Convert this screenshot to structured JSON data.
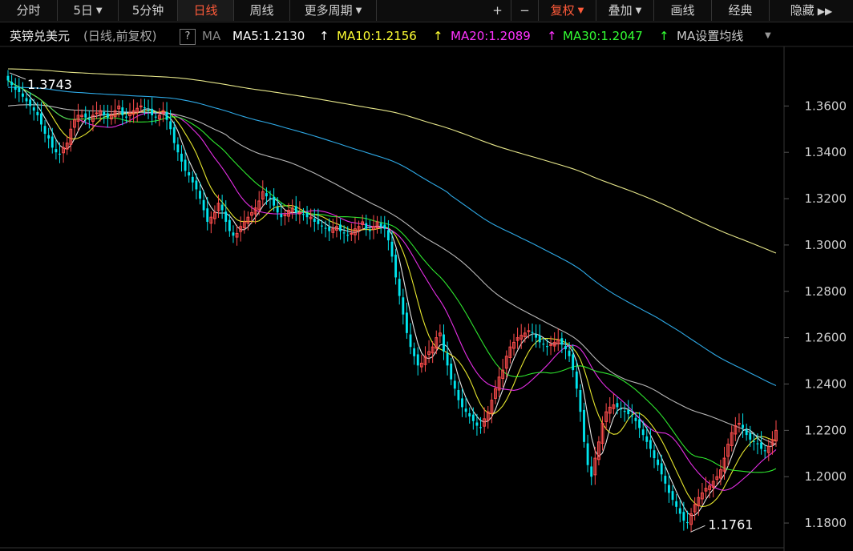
{
  "toolbar": {
    "tabs": [
      "分时",
      "5日",
      "5分钟",
      "日线",
      "周线",
      "更多周期"
    ],
    "active_tab": "日线",
    "right": [
      "+",
      "−",
      "复权",
      "叠加",
      "画线",
      "经典",
      "隐藏"
    ]
  },
  "legend": {
    "symbol": "英镑兑美元",
    "mode": "(日线,前复权)",
    "help": "?",
    "ma_label": "MA",
    "ma5": "MA5:1.2130",
    "ma10": "MA10:1.2156",
    "ma20": "MA20:1.2089",
    "ma30": "MA30:1.2047",
    "ma_setting": "MA设置均线",
    "arrow": "↑"
  },
  "colors": {
    "up": "#ff4d4d",
    "down": "#00e5ee",
    "ma5": "#ffffff",
    "ma10": "#ffff33",
    "ma20": "#ff33ff",
    "ma30": "#33ff33",
    "ma60": "#cccccc",
    "ma120": "#33bbff",
    "ma250": "#ffff99"
  },
  "chart_data": {
    "type": "candlestick",
    "title": "英镑兑美元",
    "ylim": [
      1.17,
      1.385
    ],
    "yticks": [
      "1.3600",
      "1.3400",
      "1.3200",
      "1.3000",
      "1.2800",
      "1.2600",
      "1.2400",
      "1.2200",
      "1.2000",
      "1.1800"
    ],
    "annotations": {
      "high": "1.3743",
      "low": "1.1761"
    },
    "close": [
      1.371,
      1.369,
      1.367,
      1.366,
      1.364,
      1.362,
      1.36,
      1.358,
      1.356,
      1.352,
      1.348,
      1.346,
      1.342,
      1.34,
      1.339,
      1.342,
      1.344,
      1.35,
      1.354,
      1.356,
      1.356,
      1.355,
      1.354,
      1.356,
      1.357,
      1.358,
      1.356,
      1.355,
      1.356,
      1.358,
      1.36,
      1.356,
      1.355,
      1.357,
      1.358,
      1.359,
      1.36,
      1.359,
      1.358,
      1.356,
      1.355,
      1.356,
      1.358,
      1.354,
      1.35,
      1.344,
      1.34,
      1.336,
      1.332,
      1.33,
      1.327,
      1.324,
      1.32,
      1.315,
      1.31,
      1.312,
      1.314,
      1.318,
      1.315,
      1.31,
      1.306,
      1.304,
      1.305,
      1.308,
      1.31,
      1.312,
      1.314,
      1.316,
      1.319,
      1.323,
      1.321,
      1.32,
      1.317,
      1.314,
      1.312,
      1.313,
      1.315,
      1.316,
      1.314,
      1.314,
      1.313,
      1.312,
      1.312,
      1.31,
      1.309,
      1.308,
      1.307,
      1.306,
      1.307,
      1.308,
      1.306,
      1.305,
      1.304,
      1.305,
      1.307,
      1.308,
      1.31,
      1.307,
      1.306,
      1.308,
      1.31,
      1.308,
      1.307,
      1.302,
      1.295,
      1.286,
      1.278,
      1.27,
      1.262,
      1.256,
      1.252,
      1.248,
      1.249,
      1.252,
      1.254,
      1.256,
      1.26,
      1.262,
      1.254,
      1.248,
      1.242,
      1.238,
      1.233,
      1.23,
      1.228,
      1.226,
      1.224,
      1.222,
      1.221,
      1.225,
      1.228,
      1.233,
      1.238,
      1.243,
      1.246,
      1.252,
      1.256,
      1.258,
      1.26,
      1.261,
      1.262,
      1.263,
      1.262,
      1.26,
      1.258,
      1.257,
      1.256,
      1.257,
      1.258,
      1.259,
      1.257,
      1.255,
      1.252,
      1.246,
      1.238,
      1.228,
      1.215,
      1.205,
      1.2,
      1.208,
      1.215,
      1.223,
      1.228,
      1.23,
      1.231,
      1.23,
      1.229,
      1.228,
      1.227,
      1.226,
      1.224,
      1.221,
      1.218,
      1.215,
      1.212,
      1.208,
      1.205,
      1.201,
      1.197,
      1.193,
      1.19,
      1.187,
      1.184,
      1.181,
      1.18,
      1.184,
      1.188,
      1.191,
      1.193,
      1.195,
      1.196,
      1.198,
      1.2,
      1.203,
      1.208,
      1.214,
      1.219,
      1.222,
      1.223,
      1.221,
      1.218,
      1.216,
      1.215,
      1.214,
      1.212,
      1.211,
      1.213,
      1.216,
      1.22
    ]
  }
}
